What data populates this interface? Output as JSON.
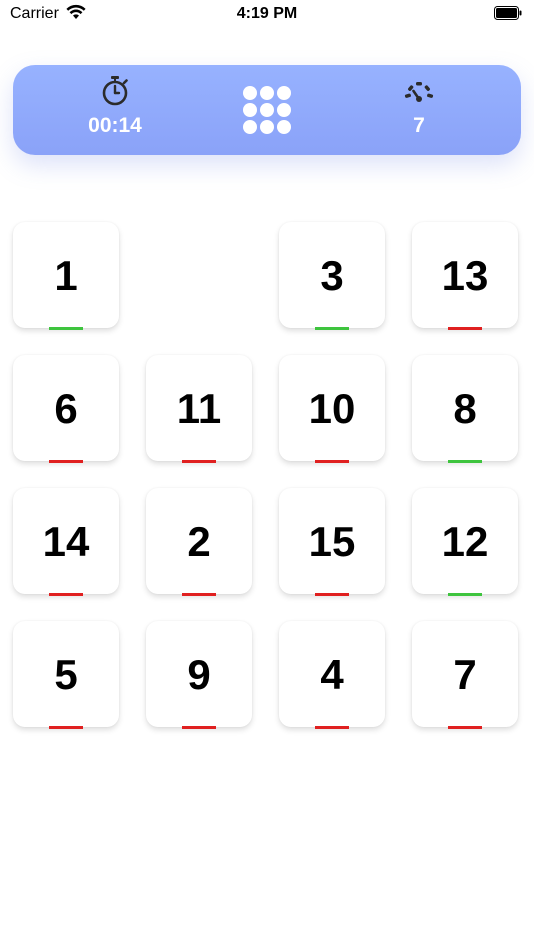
{
  "status_bar": {
    "carrier": "Carrier",
    "time": "4:19 PM"
  },
  "header": {
    "timer_value": "00:14",
    "moves_value": "7",
    "icons": [
      "stopwatch-icon",
      "grid-dots-icon",
      "speedometer-icon"
    ]
  },
  "colors": {
    "header_gradient_top": "#97b2ff",
    "header_gradient_bottom": "#8aa2f8",
    "correct": "#3ec43e",
    "incorrect": "#e02020"
  },
  "board": {
    "rows": [
      [
        {
          "label": "1",
          "status": "correct"
        },
        null,
        {
          "label": "3",
          "status": "correct"
        },
        {
          "label": "13",
          "status": "incorrect"
        }
      ],
      [
        {
          "label": "6",
          "status": "incorrect"
        },
        {
          "label": "11",
          "status": "incorrect"
        },
        {
          "label": "10",
          "status": "incorrect"
        },
        {
          "label": "8",
          "status": "correct"
        }
      ],
      [
        {
          "label": "14",
          "status": "incorrect"
        },
        {
          "label": "2",
          "status": "incorrect"
        },
        {
          "label": "15",
          "status": "incorrect"
        },
        {
          "label": "12",
          "status": "correct"
        }
      ],
      [
        {
          "label": "5",
          "status": "incorrect"
        },
        {
          "label": "9",
          "status": "incorrect"
        },
        {
          "label": "4",
          "status": "incorrect"
        },
        {
          "label": "7",
          "status": "incorrect"
        }
      ]
    ]
  }
}
